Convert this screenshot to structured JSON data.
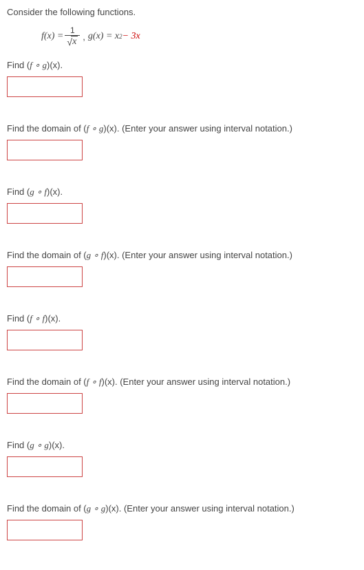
{
  "intro": "Consider the following functions.",
  "equation": {
    "fx_label": "f(x) = ",
    "gx_label": "g(x) = x",
    "minus3x": " − 3x",
    "sqrt_x": "x",
    "numerator": "1"
  },
  "problems": [
    {
      "pre": "Find  (",
      "comp": "f ∘ g",
      "post": ")(x).",
      "answer": "",
      "accent": "red"
    },
    {
      "pre": "Find the domain of  (",
      "comp": "f ∘ g",
      "post": ")(x).  (Enter your answer using interval notation.)",
      "answer": "",
      "accent": "red"
    },
    {
      "pre": "Find  (",
      "comp": "g ∘ f",
      "post": ")(x).",
      "answer": "",
      "accent": "red"
    },
    {
      "pre": "Find the domain of  (",
      "comp": "g ∘ f",
      "post": ")(x).  (Enter your answer using interval notation.)",
      "answer": "",
      "accent": "red"
    },
    {
      "pre": "Find  (",
      "comp": "f ∘ f",
      "post": ")(x).",
      "answer": "",
      "accent": "red"
    },
    {
      "pre": "Find the domain of  (",
      "comp": "f ∘ f",
      "post": ")(x).  (Enter your answer using interval notation.)",
      "answer": "",
      "accent": "red"
    },
    {
      "pre": "Find  (",
      "comp": "g ∘ g",
      "post": ")(x).",
      "answer": "",
      "accent": "red"
    },
    {
      "pre": "Find the domain of  (",
      "comp": "g ∘ g",
      "post": ")(x).  (Enter your answer using interval notation.)",
      "answer": "",
      "accent": "red"
    }
  ]
}
